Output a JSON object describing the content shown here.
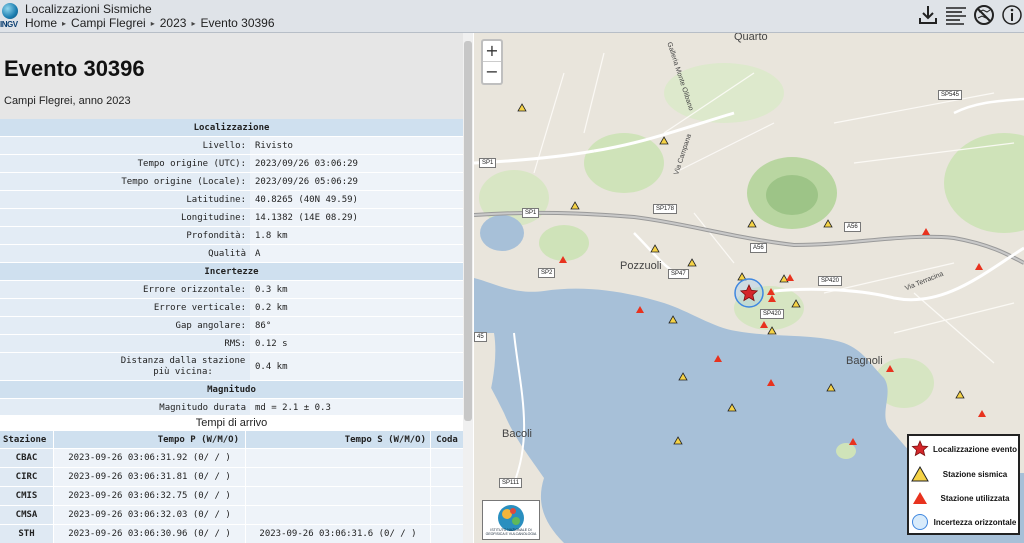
{
  "header": {
    "logo_text": "INGV",
    "app_title": "Localizzazioni Sismiche",
    "breadcrumb": [
      "Home",
      "Campi Flegrei",
      "2023",
      "Evento 30396"
    ],
    "icons": [
      "download-icon",
      "list-icon",
      "no-map-icon",
      "info-icon"
    ]
  },
  "event": {
    "title": "Evento 30396",
    "subtitle": "Campi Flegrei, anno 2023"
  },
  "localizzazione": {
    "section": "Localizzazione",
    "rows": [
      {
        "k": "Livello:",
        "v": "Rivisto"
      },
      {
        "k": "Tempo origine (UTC):",
        "v": "2023/09/26 03:06:29"
      },
      {
        "k": "Tempo origine (Locale):",
        "v": "2023/09/26 05:06:29"
      },
      {
        "k": "Latitudine:",
        "v": "40.8265 (40N 49.59)"
      },
      {
        "k": "Longitudine:",
        "v": "14.1382 (14E 08.29)"
      },
      {
        "k": "Profondità:",
        "v": "1.8 km"
      },
      {
        "k": "Qualità",
        "v": "A"
      }
    ]
  },
  "incertezze": {
    "section": "Incertezze",
    "rows": [
      {
        "k": "Errore orizzontale:",
        "v": "0.3 km"
      },
      {
        "k": "Errore verticale:",
        "v": "0.2 km"
      },
      {
        "k": "Gap angolare:",
        "v": "86°"
      },
      {
        "k": "RMS:",
        "v": "0.12 s"
      },
      {
        "k": "Distanza dalla stazione più vicina:",
        "v": "0.4 km"
      }
    ]
  },
  "magnitudo": {
    "section": "Magnitudo",
    "rows": [
      {
        "k": "Magnitudo durata",
        "v": "md = 2.1 ± 0.3"
      }
    ]
  },
  "arrivals": {
    "title": "Tempi di arrivo",
    "headers": [
      "Stazione",
      "Tempo P (W/M/O)",
      "Tempo S (W/M/O)",
      "Coda"
    ],
    "rows": [
      {
        "station": "CBAC",
        "p": "2023-09-26 03:06:31.92 (0/ / )",
        "s": "",
        "coda": ""
      },
      {
        "station": "CIRC",
        "p": "2023-09-26 03:06:31.81 (0/ / )",
        "s": "",
        "coda": ""
      },
      {
        "station": "CMIS",
        "p": "2023-09-26 03:06:32.75 (0/ / )",
        "s": "",
        "coda": ""
      },
      {
        "station": "CMSA",
        "p": "2023-09-26 03:06:32.03 (0/ / )",
        "s": "",
        "coda": ""
      },
      {
        "station": "STH",
        "p": "2023-09-26 03:06:30.96 (0/ / )",
        "s": "2023-09-26 03:06:31.6 (0/ / )",
        "coda": ""
      }
    ]
  },
  "map": {
    "zoom_in": "+",
    "zoom_out": "−",
    "places": [
      "Quarto",
      "Pozzuoli",
      "Bagnoli",
      "Bacoli"
    ],
    "roads": [
      "SP545",
      "SP1",
      "SP1",
      "SP178",
      "SP2",
      "SP47",
      "SP420",
      "SP420",
      "A56",
      "A56",
      "SP111",
      "45",
      "Via Campana",
      "Via Terracina",
      "Galleria Monte Olibano"
    ],
    "logo_text": "ISTITUTO NAZIONALE DI GEOFISICA E VULCANOLOGIA",
    "legend": {
      "event": "Localizzazione evento",
      "seismic_station": "Stazione sismica",
      "used_station": "Stazione utilizzata",
      "uncertainty": "Incertezza orizzontale"
    },
    "colors": {
      "sea": "#a7c0d8",
      "land": "#e9e5dc",
      "green": "#cfe3b9",
      "station_yellow": "#f5d246",
      "station_red": "#e8321e",
      "event_star": "#d4262a",
      "uncertainty_circle": "#3f87e0"
    }
  }
}
